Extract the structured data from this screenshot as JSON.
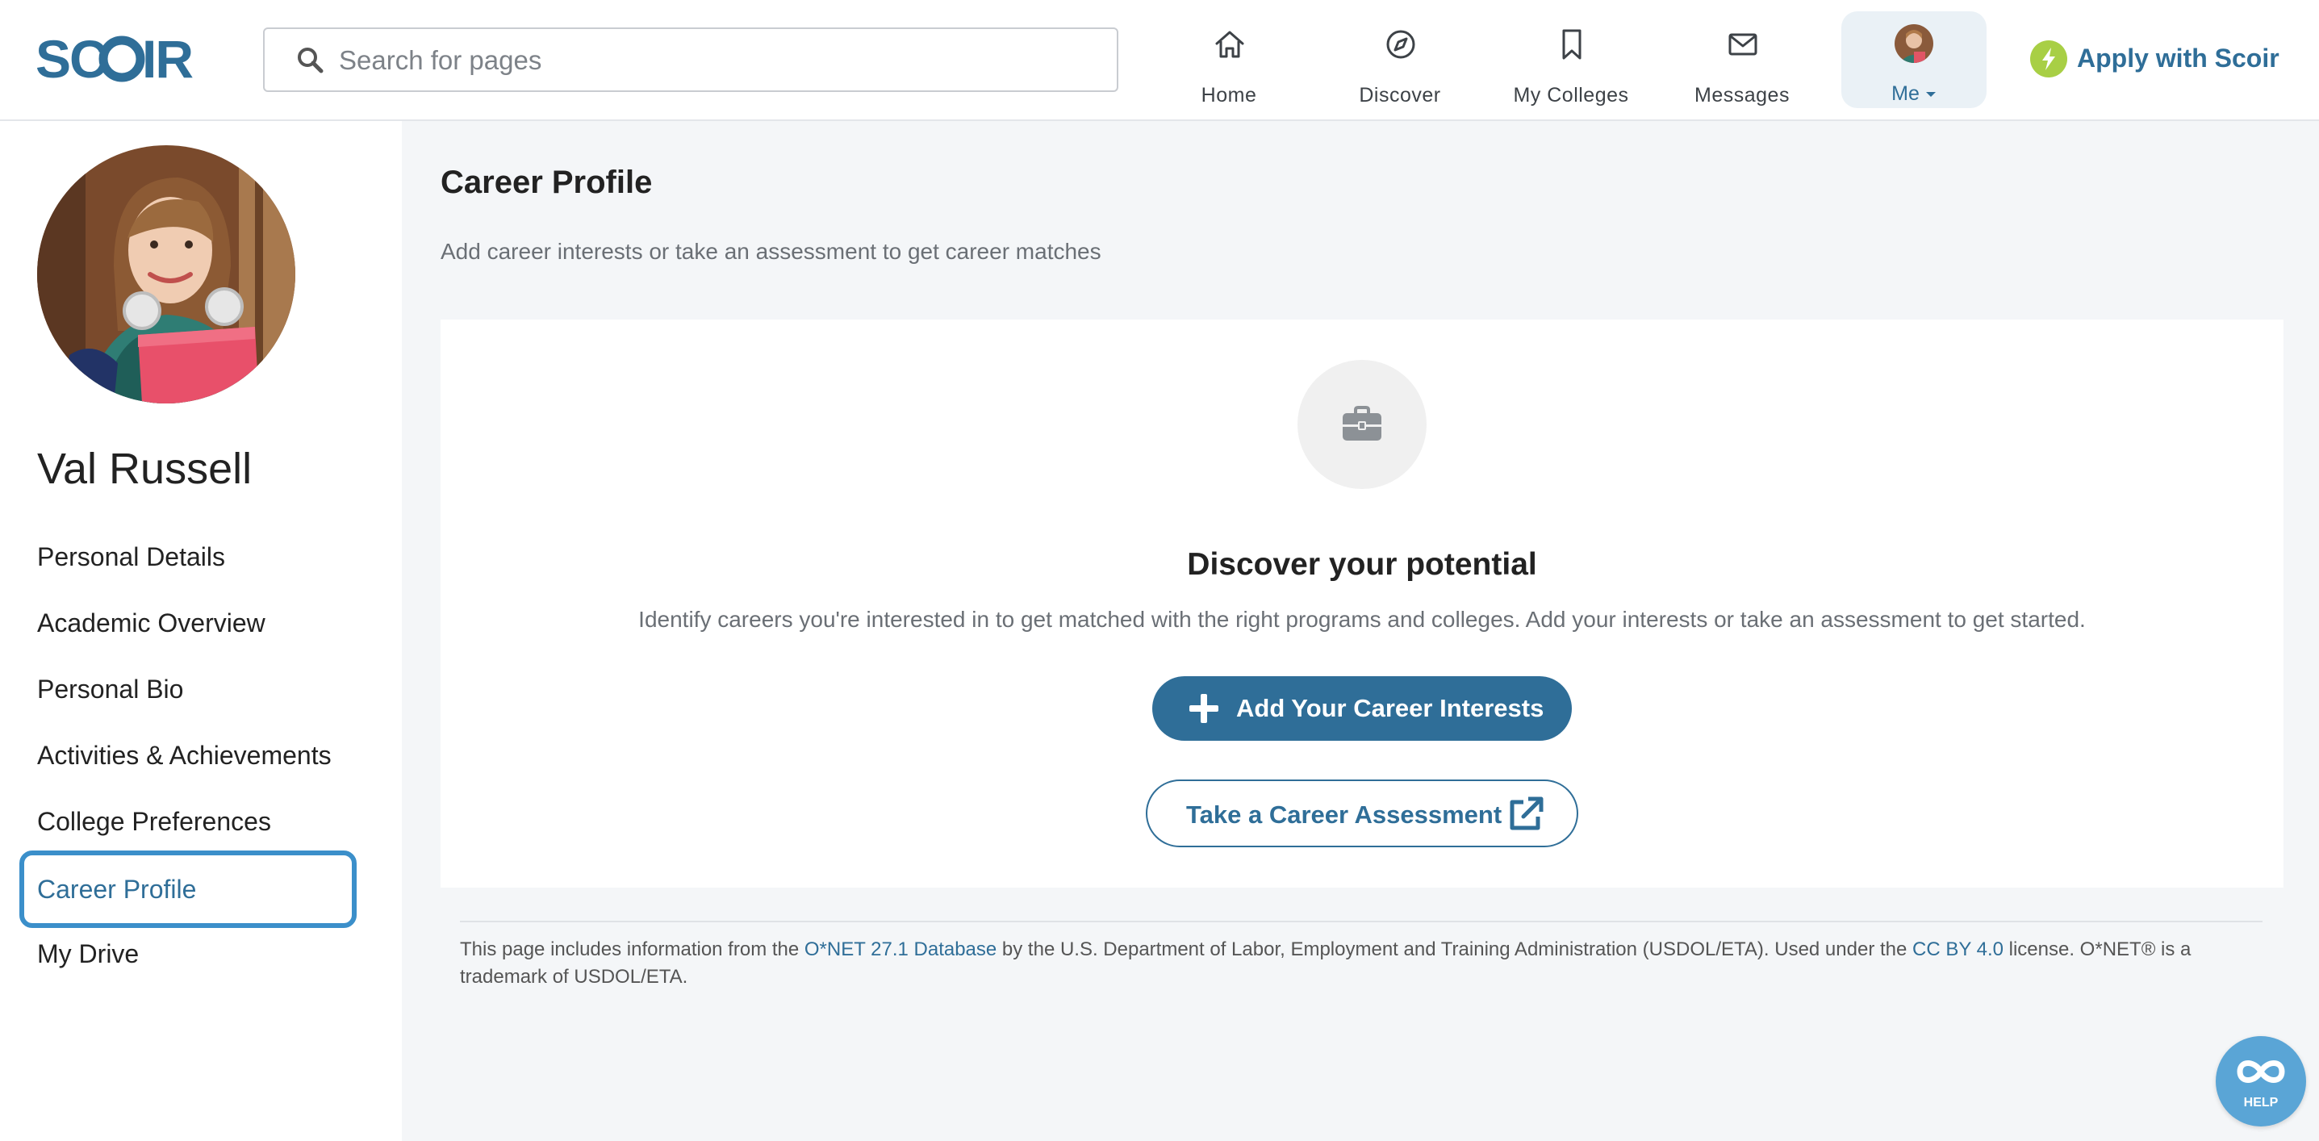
{
  "header": {
    "logo_text": "SCOIR",
    "search": {
      "placeholder": "Search for pages",
      "value": ""
    },
    "nav": [
      {
        "label": "Home",
        "icon": "home-icon"
      },
      {
        "label": "Discover",
        "icon": "compass-icon"
      },
      {
        "label": "My Colleges",
        "icon": "bookmark-icon"
      },
      {
        "label": "Messages",
        "icon": "envelope-icon"
      }
    ],
    "me_label": "Me",
    "apply_label": "Apply with Scoir"
  },
  "sidebar": {
    "name": "Val Russell",
    "links": [
      "Personal Details",
      "Academic Overview",
      "Personal Bio",
      "Activities & Achievements",
      "College Preferences",
      "Career Profile",
      "My Drive"
    ],
    "active_index": 5
  },
  "main": {
    "title": "Career Profile",
    "subtitle": "Add career interests or take an assessment to get career matches",
    "card": {
      "icon": "briefcase-icon",
      "heading": "Discover your potential",
      "description": "Identify careers you're interested in to get matched with the right programs and colleges. Add your interests or take an assessment to get started.",
      "primary_button": "Add Your Career Interests",
      "secondary_button": "Take a Career Assessment"
    }
  },
  "footer": {
    "text_1": "This page includes information from the ",
    "link_1": "O*NET 27.1 Database",
    "text_2": " by the U.S. Department of Labor, Employment and Training Administration (USDOL/ETA). Used under the ",
    "link_2": "CC BY 4.0",
    "text_3": " license. O*NET® is a trademark of USDOL/ETA."
  },
  "help_label": "HELP",
  "colors": {
    "brand": "#2f6e98",
    "accent_blue": "#3b8fca",
    "apply_bolt": "#a8cf45",
    "page_bg": "#f4f6f8"
  }
}
